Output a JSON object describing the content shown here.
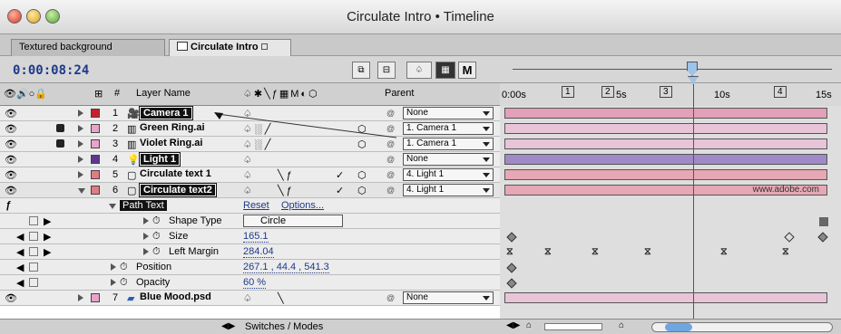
{
  "window": {
    "title": "Circulate Intro • Timeline"
  },
  "tabs": [
    {
      "label": "Textured background"
    },
    {
      "label": "Circulate Intro"
    }
  ],
  "time": {
    "current": "0:00:08:24"
  },
  "columns": {
    "layer_name": "Layer Name",
    "hash": "#",
    "parent": "Parent"
  },
  "ruler": {
    "ticks": [
      "0:00s",
      "5s",
      "10s",
      "15s"
    ],
    "markers": [
      "1",
      "2",
      "3",
      "4"
    ]
  },
  "layers": [
    {
      "num": "1",
      "name": "Camera 1",
      "color": "#c8202a",
      "parent": "None",
      "kind": "camera"
    },
    {
      "num": "2",
      "name": "Green Ring.ai",
      "color": "#e8a4c8",
      "parent": "1. Camera 1",
      "kind": "footage"
    },
    {
      "num": "3",
      "name": "Violet Ring.ai",
      "color": "#e8a4c8",
      "parent": "1. Camera 1",
      "kind": "footage"
    },
    {
      "num": "4",
      "name": "Light 1",
      "color": "#5a3a8e",
      "parent": "None",
      "kind": "light"
    },
    {
      "num": "5",
      "name": "Circulate text 1",
      "color": "#e07c84",
      "parent": "4. Light 1",
      "kind": "text"
    },
    {
      "num": "6",
      "name": "Circulate text2",
      "color": "#e07c84",
      "parent": "4. Light 1",
      "kind": "text"
    },
    {
      "num": "7",
      "name": "Blue Mood.psd",
      "color": "#e8a4c8",
      "parent": "None",
      "kind": "footage"
    }
  ],
  "path_text": {
    "label": "Path Text",
    "reset": "Reset",
    "options": "Options...",
    "props": [
      {
        "name": "Shape Type",
        "value": "Circle"
      },
      {
        "name": "Size",
        "value": "165.1"
      },
      {
        "name": "Left Margin",
        "value": "284.04"
      }
    ]
  },
  "transform_props": [
    {
      "name": "Position",
      "value": "267.1 , 44.4 , 541.3"
    },
    {
      "name": "Opacity",
      "value": "60 %"
    }
  ],
  "watermark": "www.adobe.com",
  "footer": {
    "switches_modes": "Switches / Modes"
  }
}
